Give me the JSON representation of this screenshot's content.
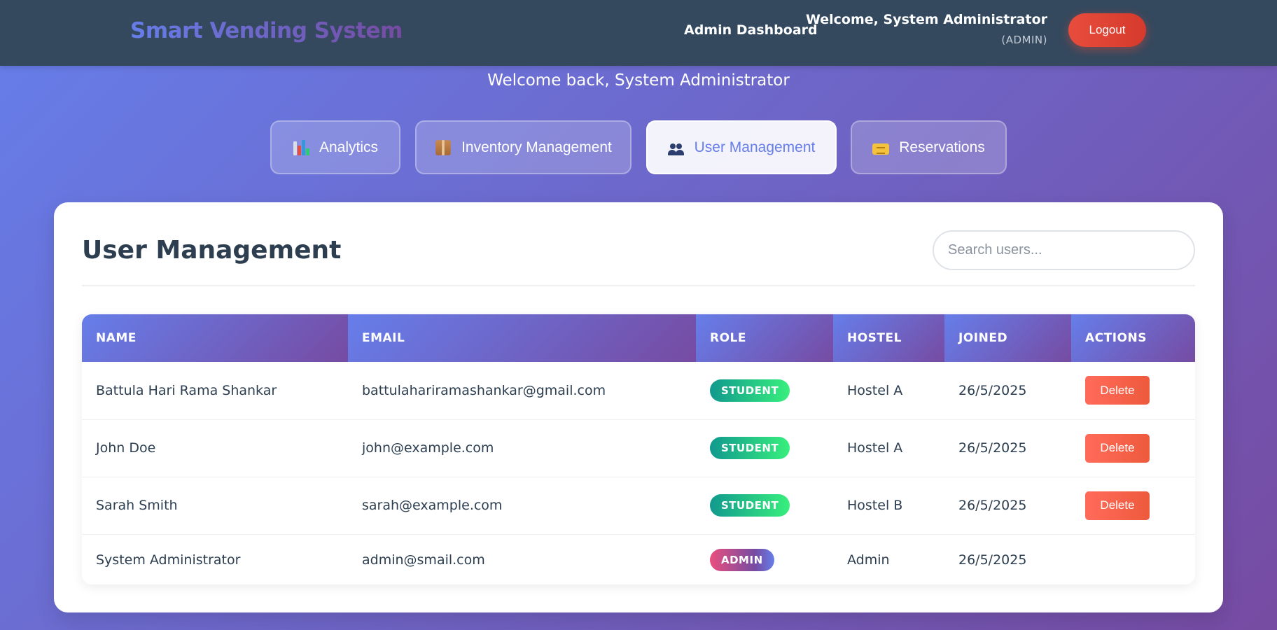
{
  "header": {
    "brand": "Smart Vending System",
    "nav_link": "Admin Dashboard",
    "welcome": "Welcome, System Administrator",
    "role": "(ADMIN)",
    "logout_label": "Logout"
  },
  "sub_welcome": "Welcome back, System Administrator",
  "tabs": [
    {
      "label": "Analytics",
      "icon": "bar-chart-icon",
      "active": false
    },
    {
      "label": "Inventory Management",
      "icon": "package-icon",
      "active": false
    },
    {
      "label": "User Management",
      "icon": "people-icon",
      "active": true
    },
    {
      "label": "Reservations",
      "icon": "ticket-icon",
      "active": false
    }
  ],
  "main": {
    "title": "User Management",
    "search_placeholder": "Search users...",
    "search_value": ""
  },
  "table": {
    "columns": [
      "NAME",
      "EMAIL",
      "ROLE",
      "HOSTEL",
      "JOINED",
      "ACTIONS"
    ],
    "rows": [
      {
        "name": "Battula Hari Rama Shankar",
        "email": "battulahariramashankar@gmail.com",
        "role": "STUDENT",
        "hostel": "Hostel A",
        "joined": "26/5/2025",
        "action": "Delete"
      },
      {
        "name": "John Doe",
        "email": "john@example.com",
        "role": "STUDENT",
        "hostel": "Hostel A",
        "joined": "26/5/2025",
        "action": "Delete"
      },
      {
        "name": "Sarah Smith",
        "email": "sarah@example.com",
        "role": "STUDENT",
        "hostel": "Hostel B",
        "joined": "26/5/2025",
        "action": "Delete"
      },
      {
        "name": "System Administrator",
        "email": "admin@smail.com",
        "role": "ADMIN",
        "hostel": "Admin",
        "joined": "26/5/2025",
        "action": ""
      }
    ]
  },
  "colors": {
    "header_bg": "#34495e",
    "gradient_start": "#667eea",
    "gradient_end": "#764ba2",
    "logout": "#e74c3c",
    "delete": "#ff6b5a",
    "student_badge": "#11998e",
    "text_dark": "#2c3e50"
  }
}
